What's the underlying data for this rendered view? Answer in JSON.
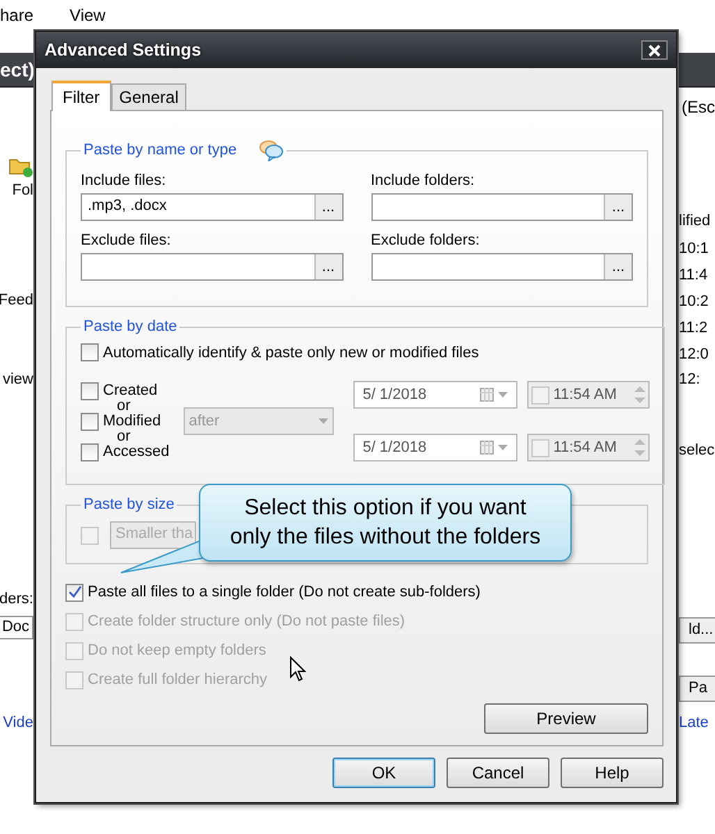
{
  "background_window": {
    "menu": [
      "hare",
      "View"
    ],
    "title_fragment": "ect)",
    "header_fragment": "(Esc",
    "left": [
      {
        "kind": "toolbar",
        "text": "Fol"
      },
      {
        "kind": "row",
        "text": "Feed"
      },
      {
        "kind": "row",
        "text": "view"
      },
      {
        "kind": "label",
        "text": "ders:"
      },
      {
        "kind": "field",
        "text": "Doc"
      },
      {
        "kind": "link",
        "text": "Vide"
      }
    ],
    "right": [
      {
        "kind": "header",
        "text": "lified"
      },
      {
        "kind": "row",
        "text": "10:1"
      },
      {
        "kind": "row",
        "text": "11:4"
      },
      {
        "kind": "row",
        "text": "10:2"
      },
      {
        "kind": "row",
        "text": "11:2"
      },
      {
        "kind": "row",
        "text": "12:0"
      },
      {
        "kind": "row",
        "text": "12:"
      },
      {
        "kind": "label",
        "text": "selec"
      },
      {
        "kind": "button",
        "text": "ld..."
      },
      {
        "kind": "button",
        "text": "Pa"
      },
      {
        "kind": "link",
        "text": "Late"
      }
    ]
  },
  "dialog": {
    "title": "Advanced Settings",
    "tabs": [
      {
        "label": "Filter",
        "selected": true
      },
      {
        "label": "General",
        "selected": false
      }
    ],
    "name_group": {
      "legend": "Paste by name or type",
      "fields": [
        {
          "label": "Include files:",
          "value": ".mp3, .docx",
          "browse": "..."
        },
        {
          "label": "Include folders:",
          "browse": "..."
        },
        {
          "label": "Exclude files:",
          "browse": "..."
        },
        {
          "label": "Exclude folders:",
          "browse": "..."
        }
      ]
    },
    "date_group": {
      "legend": "Paste by date",
      "auto": {
        "label": "Automatically identify & paste only new or modified files",
        "checked": false
      },
      "events": [
        {
          "label": "Created",
          "checked": false
        },
        {
          "label": "Modified",
          "checked": false
        },
        {
          "label": "Accessed",
          "checked": false
        }
      ],
      "separators": [
        "or",
        "or"
      ],
      "comparison": {
        "value": "after",
        "disabled": true
      },
      "ranges": [
        {
          "date": "5/  1/2018",
          "time": "11:54 AM",
          "time_checked": false
        },
        {
          "date": "5/  1/2018",
          "time": "11:54 AM",
          "time_checked": false
        }
      ]
    },
    "size_group": {
      "legend": "Paste by size",
      "checked": false,
      "comparison": "Smaller tha"
    },
    "options": [
      {
        "label": "Paste all files to a single folder (Do not create sub-folders)",
        "checked": true,
        "disabled": false
      },
      {
        "label": "Create folder structure only (Do not paste files)",
        "checked": false,
        "disabled": true
      },
      {
        "label": "Do not keep empty folders",
        "checked": false,
        "disabled": true
      },
      {
        "label": "Create full folder hierarchy",
        "checked": false,
        "disabled": true
      }
    ],
    "preview_button": "Preview",
    "buttons": [
      {
        "label": "OK",
        "default": true
      },
      {
        "label": "Cancel",
        "default": false
      },
      {
        "label": "Help",
        "default": false
      }
    ]
  },
  "callout": {
    "lines": [
      "Select this option if you want",
      "only the files without the folders"
    ]
  }
}
